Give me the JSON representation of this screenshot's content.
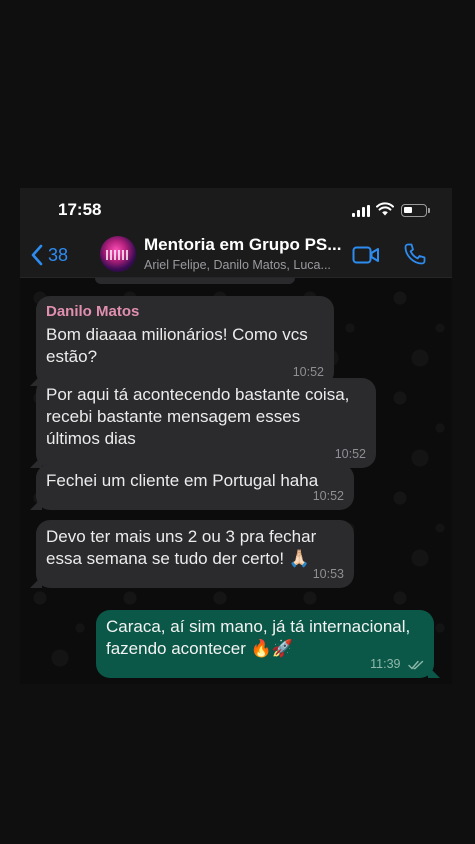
{
  "status": {
    "time": "17:58"
  },
  "header": {
    "back_count": "38",
    "title": "Mentoria em Grupo PS...",
    "subtitle": "Ariel Felipe, Danilo Matos, Luca..."
  },
  "messages": [
    {
      "direction": "in",
      "sender": "Danilo Matos",
      "lines": [
        "Bom diaaaa milionários! Como vcs",
        "estão?"
      ],
      "time": "10:52"
    },
    {
      "direction": "in",
      "lines": [
        "Por aqui tá acontecendo bastante coisa,",
        "recebi bastante mensagem esses",
        "últimos dias"
      ],
      "time": "10:52"
    },
    {
      "direction": "in",
      "lines": [
        "Fechei um cliente em Portugal haha"
      ],
      "time": "10:52"
    },
    {
      "direction": "in",
      "lines": [
        "Devo ter mais uns 2 ou 3 pra fechar",
        "essa semana se tudo der certo! 🙏🏻"
      ],
      "time": "10:53"
    },
    {
      "direction": "out",
      "lines": [
        "Caraca, aí sim mano, já tá internacional,",
        "fazendo acontecer 🔥🚀"
      ],
      "time": "11:39",
      "read": true
    }
  ],
  "colors": {
    "accent": "#2d8cf0",
    "incoming_bubble": "#2b2b2e",
    "outgoing_bubble": "#0b5848",
    "sender_name": "#e08fae"
  },
  "icons": [
    "chevron-left-icon",
    "video-camera-icon",
    "phone-icon",
    "signal-icon",
    "wifi-icon",
    "battery-icon",
    "double-check-icon"
  ]
}
